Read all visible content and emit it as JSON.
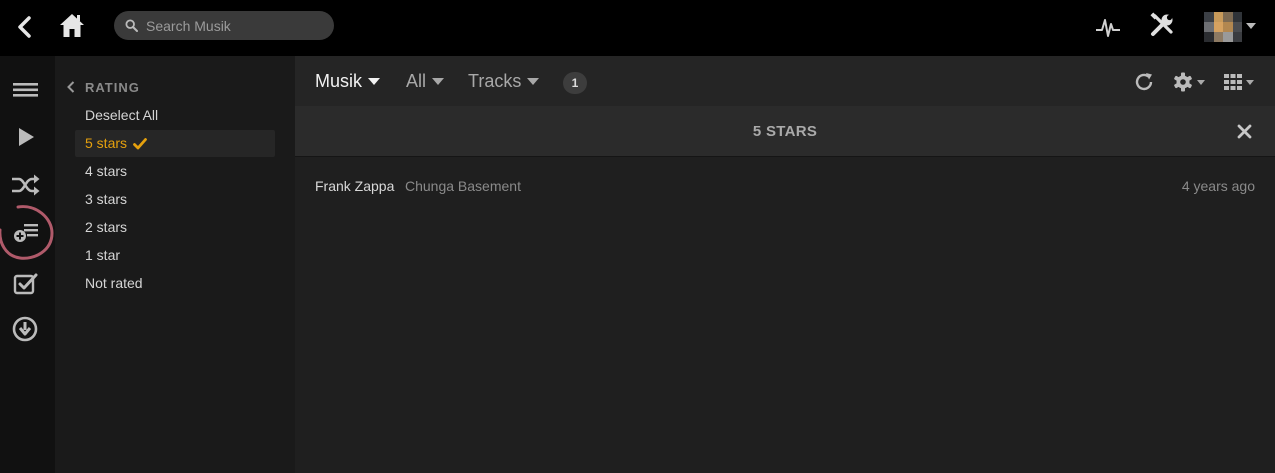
{
  "search": {
    "placeholder": "Search Musik"
  },
  "topbar": {
    "icons": [
      "back-icon",
      "home-icon",
      "activity-icon",
      "settings-tools-icon",
      "avatar"
    ],
    "avatar_colors": [
      "#3b3f45",
      "#c89a5a",
      "#7d6a52",
      "#2f3338",
      "#6d6f73",
      "#d6a260",
      "#b28750",
      "#4a4c50",
      "#2b2d31",
      "#8d7a63",
      "#9a9a9a",
      "#3a3c40"
    ]
  },
  "rail": {
    "icons": [
      "menu-icon",
      "play-icon",
      "shuffle-icon",
      "add-to-queue-icon",
      "checklist-icon",
      "download-icon"
    ]
  },
  "filters": {
    "heading": "RATING",
    "items": [
      {
        "label": "Deselect All",
        "selected": false
      },
      {
        "label": "5 stars",
        "selected": true
      },
      {
        "label": "4 stars",
        "selected": false
      },
      {
        "label": "3 stars",
        "selected": false
      },
      {
        "label": "2 stars",
        "selected": false
      },
      {
        "label": "1 star",
        "selected": false
      },
      {
        "label": "Not rated",
        "selected": false
      }
    ]
  },
  "toolbar": {
    "library": "Musik",
    "scope": "All",
    "type": "Tracks",
    "count": "1"
  },
  "filterbar": {
    "title": "5 STARS"
  },
  "tracks": [
    {
      "artist": "Frank Zappa",
      "album": "Chunga Basement",
      "added": "4 years ago"
    }
  ],
  "colors": {
    "accent": "#e5a00d",
    "annotation_circle": "#b05a6a"
  }
}
